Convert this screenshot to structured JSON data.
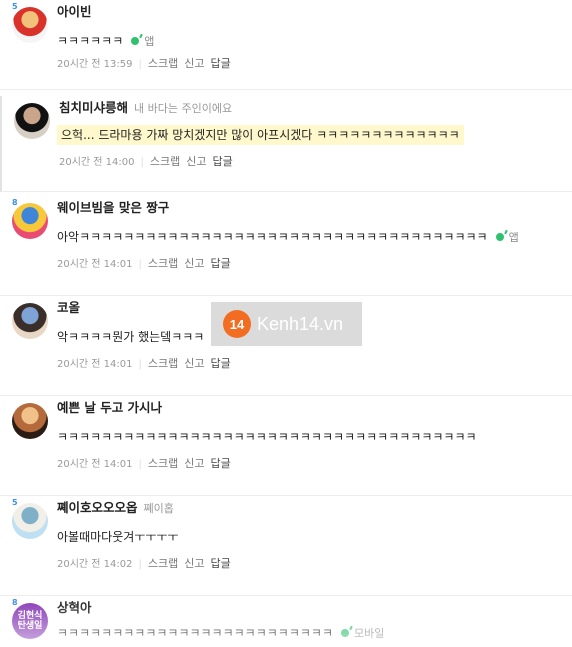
{
  "comments": [
    {
      "level": "5",
      "name": "아이빈",
      "sub": "",
      "text": "ㅋㅋㅋㅋㅋㅋ",
      "app": "앱",
      "time": "20시간 전 13:59",
      "actions": [
        "스크랩",
        "신고",
        "답글"
      ],
      "avatar_colors": [
        "#f5f5f5",
        "#d8322a",
        "#f3c27a"
      ]
    },
    {
      "level": "",
      "name": "침치미샤릉해",
      "sub": "내 바다는 주인이에요",
      "text": "으헉... 드라마용 가짜 망치겠지만 많이 아프시겠다 ㅋㅋㅋㅋㅋㅋㅋㅋㅋㅋㅋㅋㅋ",
      "app": "",
      "time": "20시간 전 14:00",
      "actions": [
        "스크랩",
        "신고",
        "답글"
      ],
      "avatar_colors": [
        "#d8cfc4",
        "#111111",
        "#c9a58c"
      ]
    },
    {
      "level": "8",
      "name": "웨이브빔을 맞은 짱구",
      "sub": "",
      "text": "아악ㅋㅋㅋㅋㅋㅋㅋㅋㅋㅋㅋㅋㅋㅋㅋㅋㅋㅋㅋㅋㅋㅋㅋㅋㅋㅋㅋㅋㅋㅋㅋㅋㅋㅋㅋㅋㅋ",
      "app": "앱",
      "time": "20시간 전 14:01",
      "actions": [
        "스크랩",
        "신고",
        "답글"
      ],
      "avatar_colors": [
        "#e94b73",
        "#f6c83a",
        "#3f86d9"
      ]
    },
    {
      "level": "",
      "name": "코올",
      "sub": "",
      "text": "악ㅋㅋㅋㅋ뭔가 했는뎈ㅋㅋㅋ",
      "app": "",
      "time": "20시간 전 14:01",
      "actions": [
        "스크랩",
        "신고",
        "답글"
      ],
      "avatar_colors": [
        "#e9d7c5",
        "#3a2e2a",
        "#7ea3d6"
      ]
    },
    {
      "level": "",
      "name": "예쁜 날 두고 가시나",
      "sub": "",
      "text": "ㅋㅋㅋㅋㅋㅋㅋㅋㅋㅋㅋㅋㅋㅋㅋㅋㅋㅋㅋㅋㅋㅋㅋㅋㅋㅋㅋㅋㅋㅋㅋㅋㅋㅋㅋㅋㅋㅋ",
      "app": "",
      "time": "20시간 전 14:01",
      "actions": [
        "스크랩",
        "신고",
        "답글"
      ],
      "avatar_colors": [
        "#2a1c14",
        "#b46a3a",
        "#f0c28a"
      ]
    },
    {
      "level": "5",
      "name": "쪠이호오오오옵",
      "sub": "쪠이홉",
      "text": "아볼때마다웃겨ㅜㅜㅜㅜ",
      "app": "",
      "time": "20시간 전 14:02",
      "actions": [
        "스크랩",
        "신고",
        "답글"
      ],
      "avatar_colors": [
        "#bfe0f2",
        "#f1efe8",
        "#7fb0c8"
      ]
    },
    {
      "level": "8",
      "name": "상혁아",
      "sub": "",
      "text": "ㅋㅋㅋㅋㅋㅋㅋㅋㅋㅋㅋㅋㅋㅋㅋㅋㅋㅋㅋㅋㅋㅋㅋㅋㅋ",
      "app": "모바일",
      "time": "",
      "actions": [],
      "avatar_colors": [
        "#8a3fb8",
        "#ffffff",
        "#f5d24a"
      ]
    }
  ],
  "avatar_text": {
    "c0": "",
    "c6": "김현식 탄생일"
  },
  "watermark": {
    "badge": "14",
    "text": "Kenh14.vn"
  }
}
